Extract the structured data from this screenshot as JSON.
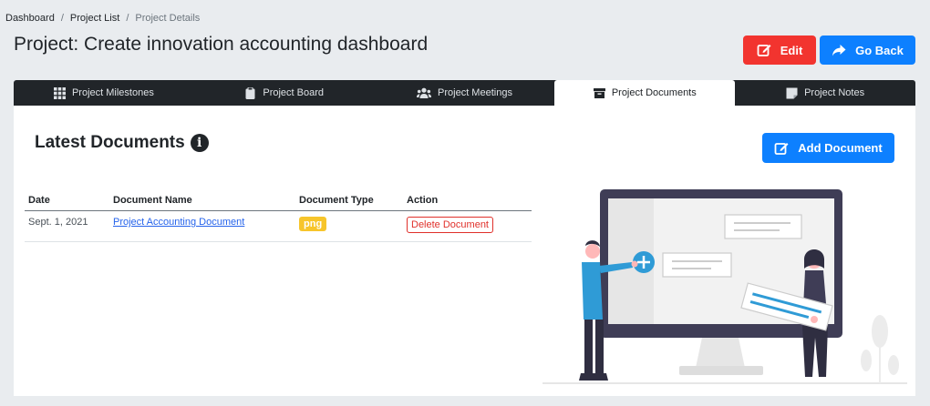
{
  "breadcrumb": {
    "items": [
      "Dashboard",
      "Project List"
    ],
    "current": "Project Details"
  },
  "page_title": "Project: Create innovation accounting dashboard",
  "header_buttons": {
    "edit": "Edit",
    "go_back": "Go Back"
  },
  "tabs": [
    {
      "label": "Project Milestones",
      "icon": "grid-icon"
    },
    {
      "label": "Project Board",
      "icon": "clipboard-icon"
    },
    {
      "label": "Project Meetings",
      "icon": "users-icon"
    },
    {
      "label": "Project Documents",
      "icon": "archive-icon",
      "active": true
    },
    {
      "label": "Project Notes",
      "icon": "sticky-note-icon"
    }
  ],
  "section": {
    "title": "Latest Documents",
    "add_button": "Add Document"
  },
  "table": {
    "headers": [
      "Date",
      "Document Name",
      "Document Type",
      "Action"
    ],
    "rows": [
      {
        "date": "Sept. 1, 2021",
        "name": "Project Accounting Document",
        "type": "png",
        "action": "Delete Document"
      }
    ]
  },
  "colors": {
    "edit": "#f2342f",
    "primary": "#0d80ff",
    "tabs_bg": "#212529",
    "badge": "#f7c52b",
    "danger": "#e0302a"
  }
}
